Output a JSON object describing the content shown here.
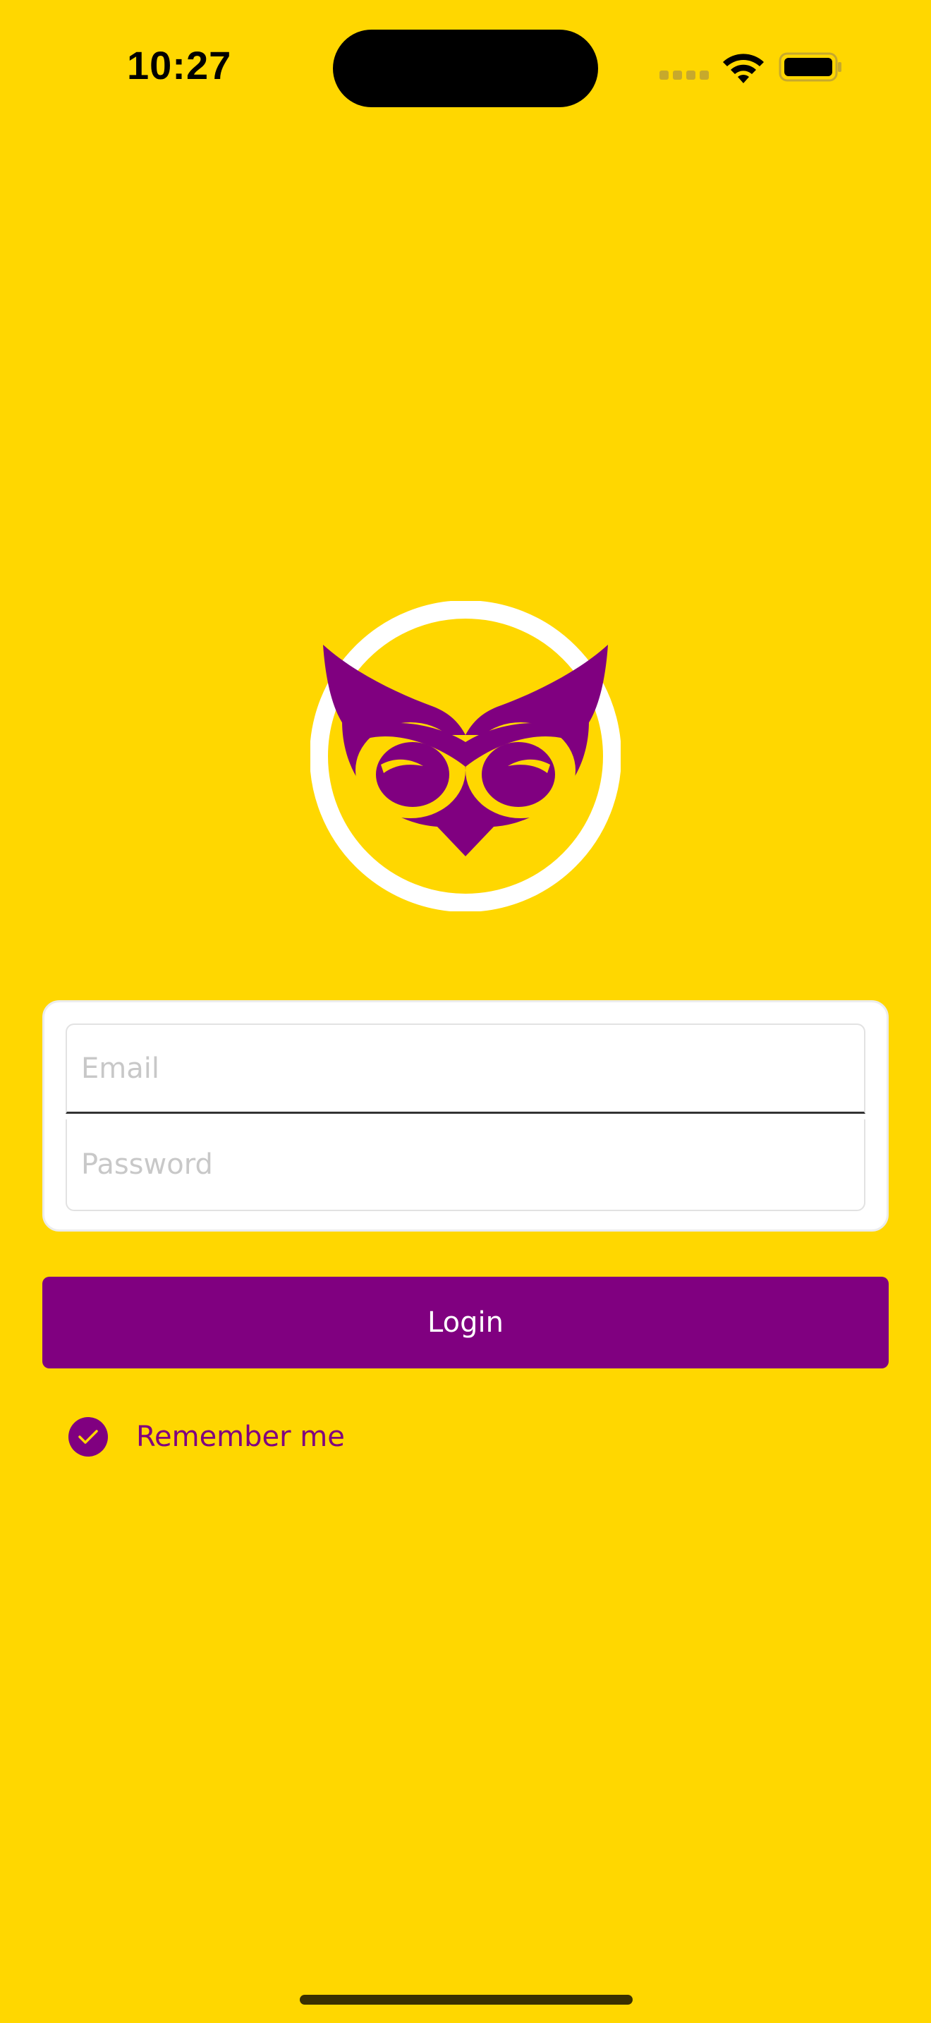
{
  "status_bar": {
    "time": "10:27"
  },
  "brand": {
    "logo_icon": "owl-logo-icon",
    "primary_color": "#800080",
    "background_color": "#FFD700"
  },
  "form": {
    "email_placeholder": "Email",
    "password_placeholder": "Password",
    "login_label": "Login",
    "remember_label": "Remember me",
    "remember_checked": true
  }
}
